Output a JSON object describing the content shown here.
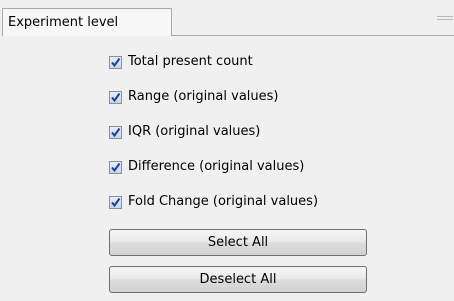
{
  "tab": {
    "label": "Experiment level"
  },
  "options": [
    {
      "label": "Total present count",
      "checked": true
    },
    {
      "label": "Range (original values)",
      "checked": true
    },
    {
      "label": "IQR (original values)",
      "checked": true
    },
    {
      "label": "Difference (original values)",
      "checked": true
    },
    {
      "label": "Fold Change (original values)",
      "checked": true
    }
  ],
  "buttons": {
    "select_all": "Select All",
    "deselect_all": "Deselect All"
  },
  "colors": {
    "panel_background": "#f0f0f0",
    "checkmark": "#1c3f8f",
    "border": "#a9a9a9"
  }
}
